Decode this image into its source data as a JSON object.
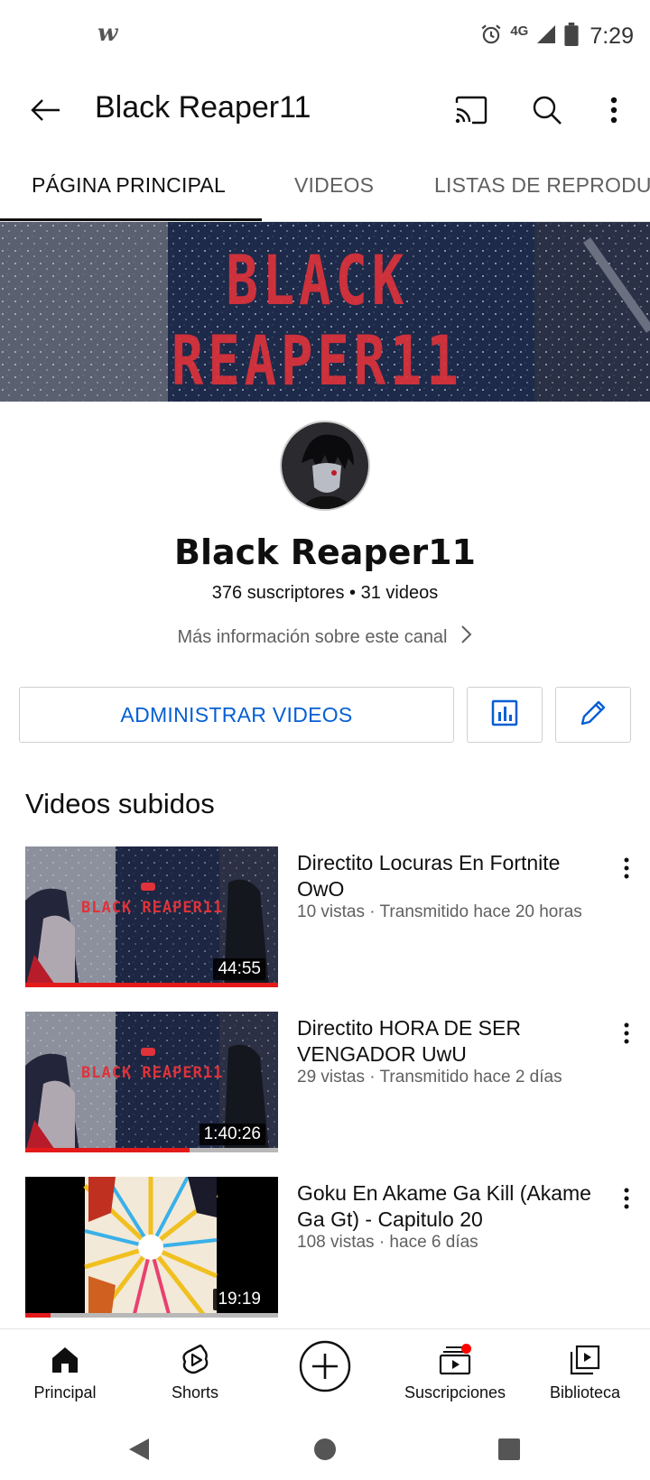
{
  "status_bar": {
    "app_icon": "w",
    "network": "4G",
    "time": "7:29",
    "icons": [
      "alarm-icon",
      "signal-icon",
      "battery-icon"
    ]
  },
  "app_bar": {
    "title": "Black Reaper11",
    "icons": [
      "back-arrow-icon",
      "cast-icon",
      "search-icon",
      "more-vert-icon"
    ]
  },
  "tabs": [
    {
      "label": "PÁGINA PRINCIPAL",
      "active": true
    },
    {
      "label": "VIDEOS",
      "active": false
    },
    {
      "label": "LISTAS DE REPRODUCCIÓN",
      "active": false
    }
  ],
  "banner": {
    "text": "BLACK REAPER11"
  },
  "channel": {
    "name": "Black Reaper11",
    "stats": "376 suscriptores • 31 videos",
    "more_info": "Más información sobre este canal"
  },
  "actions": {
    "manage_label": "ADMINISTRAR VIDEOS",
    "analytics_icon": "analytics-icon",
    "edit_icon": "edit-pencil-icon"
  },
  "section": {
    "title": "Videos subidos"
  },
  "videos": [
    {
      "title": "Directito Locuras En Fortnite OwO",
      "meta": "10 vistas · Transmitido hace 20 horas",
      "duration": "44:55",
      "progress": 1.0,
      "thumb_text": "BLACK REAPER11"
    },
    {
      "title": "Directito HORA DE SER VENGADOR UwU",
      "meta": "29 vistas · Transmitido hace 2 días",
      "duration": "1:40:26",
      "progress": 0.65,
      "thumb_text": "BLACK REAPER11"
    },
    {
      "title": "Goku En Akame Ga Kill (Akame Ga Gt) - Capitulo 20",
      "meta": "108 vistas · hace 6 días",
      "duration": "19:19",
      "progress": 0.1
    }
  ],
  "bottom_nav": [
    {
      "label": "Principal",
      "icon": "home-icon"
    },
    {
      "label": "Shorts",
      "icon": "shorts-icon"
    },
    {
      "label": "",
      "icon": "create-plus-icon"
    },
    {
      "label": "Suscripciones",
      "icon": "subscriptions-icon",
      "notification": true
    },
    {
      "label": "Biblioteca",
      "icon": "library-icon"
    }
  ],
  "colors": {
    "accent_blue": "#065fd4",
    "progress_red": "#e41a1a",
    "banner_red": "#e0323a",
    "notification_red": "#ff0000"
  }
}
